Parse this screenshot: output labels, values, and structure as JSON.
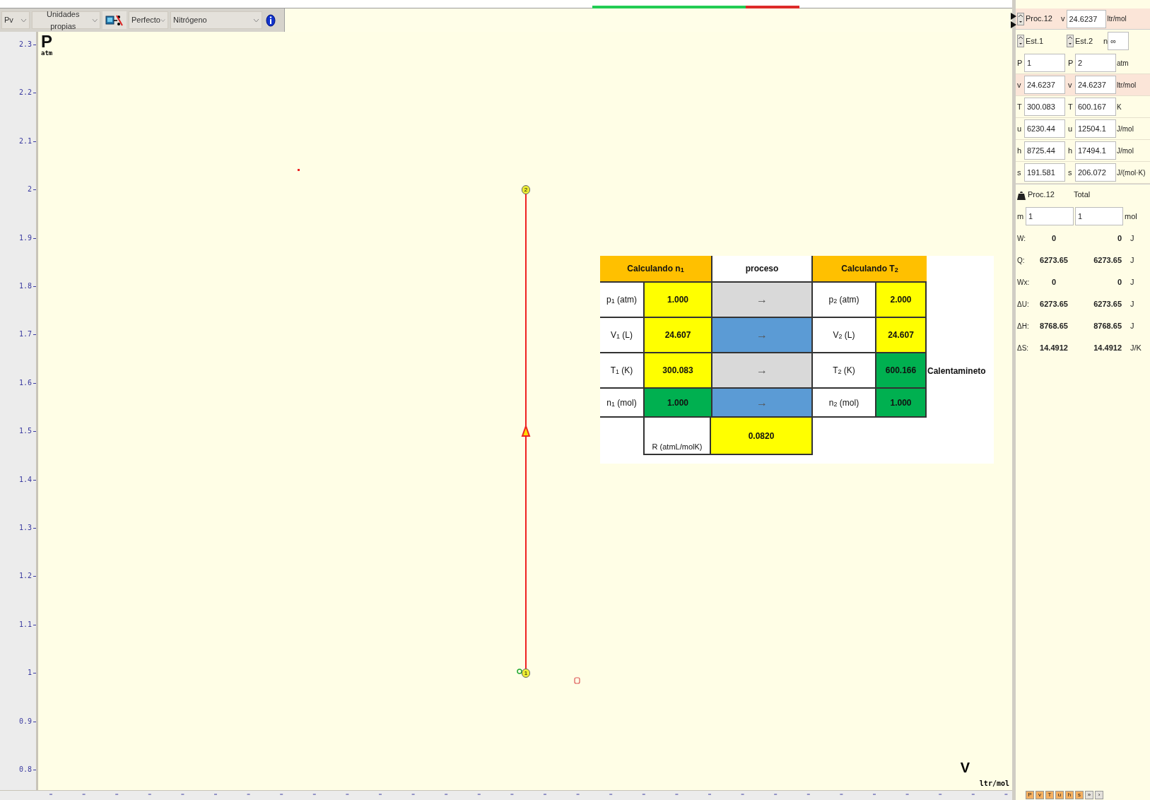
{
  "toolbar": {
    "diagram": "Pv",
    "units": "Unidades propias",
    "model": "Perfecto",
    "substance": "Nitrógeno"
  },
  "plot": {
    "y_axis": {
      "label": "P",
      "unit": "atm",
      "ticks": [
        "2.3",
        "2.2",
        "2.1",
        "2",
        "1.9",
        "1.8",
        "1.7",
        "1.6",
        "1.5",
        "1.4",
        "1.3",
        "1.2",
        "1.1",
        "1",
        "0.9",
        "0.8"
      ]
    },
    "x_axis": {
      "label": "V",
      "unit": "ltr/mol"
    },
    "states": [
      {
        "label": "2"
      },
      {
        "label": "1"
      }
    ]
  },
  "calc_table": {
    "headers": [
      {
        "text": "Calculando n$_{1}$",
        "color": "#ffc000"
      },
      {
        "text": "proceso",
        "color": "#ffffff"
      },
      {
        "text": "Calculando  T$_{2}$",
        "color": "#ffc000"
      }
    ],
    "rows": [
      {
        "label1": "p$_{1}$ (atm)",
        "value1": {
          "text": "1.000",
          "color": "#ffff00"
        },
        "arrow": {
          "text": "→",
          "color": "#d9d9d9"
        },
        "label2": "p$_{2}$ (atm)",
        "value2": {
          "text": "2.000",
          "color": "#ffff00"
        }
      },
      {
        "label1": "V$_{1}$ (L)",
        "value1": {
          "text": "24.607",
          "color": "#ffff00"
        },
        "arrow": {
          "text": "→",
          "color": "#5b9bd5"
        },
        "label2": "V$_{2}$ (L)",
        "value2": {
          "text": "24.607",
          "color": "#ffff00"
        }
      },
      {
        "label1": "T$_{1}$ (K)",
        "value1": {
          "text": "300.083",
          "color": "#ffff00"
        },
        "arrow": {
          "text": "→",
          "color": "#d9d9d9"
        },
        "label2": "T$_{2}$ (K)",
        "value2": {
          "text": "600.166",
          "color": "#00b050"
        },
        "note": "Calentamineto"
      },
      {
        "label1": "n$_{1}$ (mol)",
        "value1": {
          "text": "1.000",
          "color": "#00b050"
        },
        "arrow": {
          "text": "→",
          "color": "#5b9bd5"
        },
        "label2": "n$_{2}$ (mol)",
        "value2": {
          "text": "1.000",
          "color": "#00b050"
        }
      }
    ],
    "r_label": "R (atmL/molK)",
    "r_value": {
      "text": "0.0820",
      "color": "#ffff00"
    }
  },
  "process_panel": {
    "process": "Proc.12",
    "v_label": "v",
    "v_value": "24.6237",
    "v_unit": "ltr/mol",
    "states": [
      "Est.1",
      "Est.2"
    ],
    "n_label": "n",
    "n_value": "∞",
    "properties": [
      {
        "highlighted": false,
        "cells": [
          {
            "symbol": "P",
            "value": "1"
          },
          {
            "symbol": "P",
            "value": "2"
          }
        ],
        "unit": "atm"
      },
      {
        "highlighted": true,
        "cells": [
          {
            "symbol": "v",
            "value": "24.6237"
          },
          {
            "symbol": "v",
            "value": "24.6237"
          }
        ],
        "unit": "ltr/mol"
      },
      {
        "highlighted": false,
        "cells": [
          {
            "symbol": "T",
            "value": "300.083"
          },
          {
            "symbol": "T",
            "value": "600.167"
          }
        ],
        "unit": "K"
      },
      {
        "highlighted": false,
        "cells": [
          {
            "symbol": "u",
            "value": "6230.44"
          },
          {
            "symbol": "u",
            "value": "12504.1"
          }
        ],
        "unit": "J/mol"
      },
      {
        "highlighted": false,
        "cells": [
          {
            "symbol": "h",
            "value": "8725.44"
          },
          {
            "symbol": "h",
            "value": "17494.1"
          }
        ],
        "unit": "J/mol"
      },
      {
        "highlighted": false,
        "cells": [
          {
            "symbol": "s",
            "value": "191.581"
          },
          {
            "symbol": "s",
            "value": "206.072"
          }
        ],
        "unit": "J/(mol·K)"
      }
    ],
    "totals": {
      "col1": "Proc.12",
      "col2": "Total",
      "mass": {
        "symbol": "m",
        "value1": "1",
        "value2": "1",
        "unit": "mol"
      },
      "rows": [
        {
          "symbol": "W:",
          "value1": "0",
          "value2": "0",
          "unit": "J"
        },
        {
          "symbol": "Q:",
          "value1": "6273.65",
          "value2": "6273.65",
          "unit": "J"
        },
        {
          "symbol": "Wx:",
          "value1": "0",
          "value2": "0",
          "unit": "J"
        },
        {
          "symbol": "ΔU:",
          "value1": "6273.65",
          "value2": "6273.65",
          "unit": "J"
        },
        {
          "symbol": "ΔH:",
          "value1": "8768.65",
          "value2": "8768.65",
          "unit": "J"
        },
        {
          "symbol": "ΔS:",
          "value1": "14.4912",
          "value2": "14.4912",
          "unit": "J/K"
        }
      ]
    }
  },
  "bottom_buttons": [
    "P",
    "v",
    "T",
    "u",
    "h",
    "s",
    "»",
    "›"
  ]
}
